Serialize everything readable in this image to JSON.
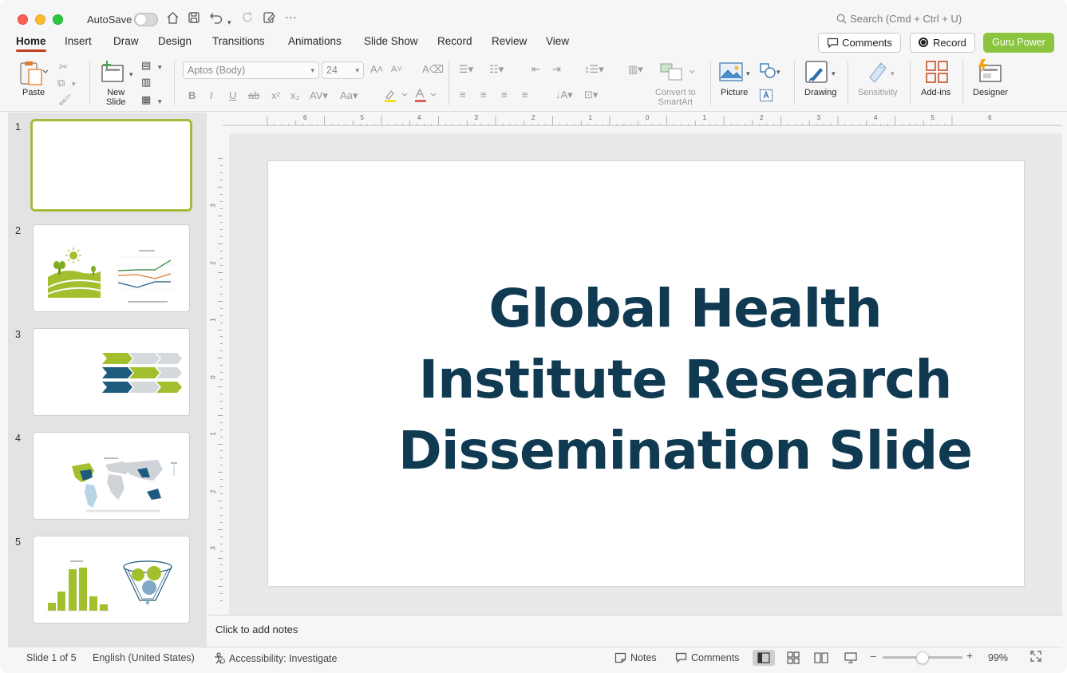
{
  "titlebar": {
    "autosave_label": "AutoSave",
    "search_placeholder": "Search (Cmd + Ctrl + U)"
  },
  "tabs": [
    {
      "label": "Home",
      "active": true
    },
    {
      "label": "Insert"
    },
    {
      "label": "Draw"
    },
    {
      "label": "Design"
    },
    {
      "label": "Transitions"
    },
    {
      "label": "Animations"
    },
    {
      "label": "Slide Show"
    },
    {
      "label": "Record"
    },
    {
      "label": "Review"
    },
    {
      "label": "View"
    }
  ],
  "header_buttons": {
    "comments": "Comments",
    "record": "Record",
    "guru": "Guru Power"
  },
  "ribbon": {
    "paste": "Paste",
    "new_slide_1": "New",
    "new_slide_2": "Slide",
    "font_name": "Aptos (Body)",
    "font_size": "24",
    "convert_1": "Convert to",
    "convert_2": "SmartArt",
    "picture": "Picture",
    "drawing": "Drawing",
    "sensitivity": "Sensitivity",
    "addins": "Add-ins",
    "designer": "Designer"
  },
  "ruler": {
    "top_ticks": [
      "6",
      "5",
      "4",
      "3",
      "2",
      "1",
      "0",
      "1",
      "2",
      "3",
      "4",
      "5",
      "6"
    ],
    "left_ticks": [
      "3",
      "2",
      "1",
      "0",
      "1",
      "2",
      "3"
    ]
  },
  "thumbnails": [
    {
      "number": "1"
    },
    {
      "number": "2"
    },
    {
      "number": "3"
    },
    {
      "number": "4"
    },
    {
      "number": "5"
    }
  ],
  "slide": {
    "title_line1": "Global Health",
    "title_line2": "Institute Research",
    "title_line3": "Dissemination Slide"
  },
  "notes_placeholder": "Click to add notes",
  "status": {
    "slide_counter": "Slide 1 of 5",
    "language": "English (United States)",
    "accessibility": "Accessibility: Investigate",
    "notes": "Notes",
    "comments": "Comments",
    "zoom": "99%"
  },
  "colors": {
    "accent_tab": "#c43e1c",
    "guru_green": "#8bc53f",
    "title_navy": "#0f3a52",
    "thumb_green": "#a2bf2e",
    "thumb_navy": "#1e5a7e"
  }
}
